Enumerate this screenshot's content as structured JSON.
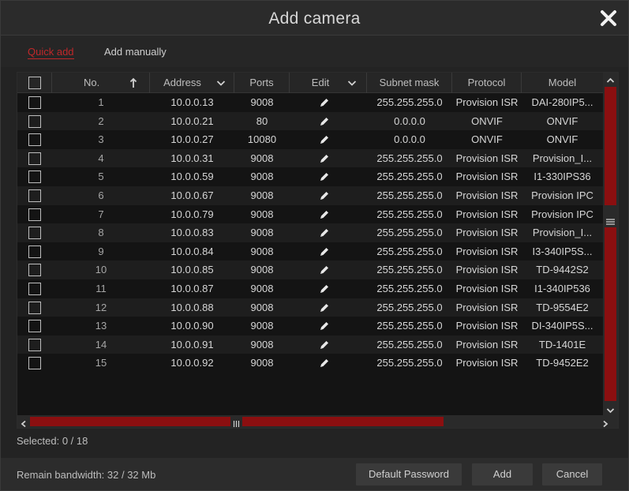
{
  "dialog": {
    "title": "Add camera",
    "close_icon": "close-icon"
  },
  "tabs": [
    {
      "label": "Quick add",
      "active": true
    },
    {
      "label": "Add manually",
      "active": false
    }
  ],
  "columns": [
    "No.",
    "Address",
    "Ports",
    "Edit",
    "Subnet mask",
    "Protocol",
    "Model"
  ],
  "rows": [
    {
      "no": "1",
      "address": "10.0.0.13",
      "port": "9008",
      "subnet": "255.255.255.0",
      "protocol": "Provision ISR",
      "model": "DAI-280IP5..."
    },
    {
      "no": "2",
      "address": "10.0.0.21",
      "port": "80",
      "subnet": "0.0.0.0",
      "protocol": "ONVIF",
      "model": "ONVIF"
    },
    {
      "no": "3",
      "address": "10.0.0.27",
      "port": "10080",
      "subnet": "0.0.0.0",
      "protocol": "ONVIF",
      "model": "ONVIF"
    },
    {
      "no": "4",
      "address": "10.0.0.31",
      "port": "9008",
      "subnet": "255.255.255.0",
      "protocol": "Provision ISR",
      "model": "Provision_I..."
    },
    {
      "no": "5",
      "address": "10.0.0.59",
      "port": "9008",
      "subnet": "255.255.255.0",
      "protocol": "Provision ISR",
      "model": "I1-330IPS36"
    },
    {
      "no": "6",
      "address": "10.0.0.67",
      "port": "9008",
      "subnet": "255.255.255.0",
      "protocol": "Provision ISR",
      "model": "Provision IPC"
    },
    {
      "no": "7",
      "address": "10.0.0.79",
      "port": "9008",
      "subnet": "255.255.255.0",
      "protocol": "Provision ISR",
      "model": "Provision IPC"
    },
    {
      "no": "8",
      "address": "10.0.0.83",
      "port": "9008",
      "subnet": "255.255.255.0",
      "protocol": "Provision ISR",
      "model": "Provision_I..."
    },
    {
      "no": "9",
      "address": "10.0.0.84",
      "port": "9008",
      "subnet": "255.255.255.0",
      "protocol": "Provision ISR",
      "model": "I3-340IP5S..."
    },
    {
      "no": "10",
      "address": "10.0.0.85",
      "port": "9008",
      "subnet": "255.255.255.0",
      "protocol": "Provision ISR",
      "model": "TD-9442S2"
    },
    {
      "no": "11",
      "address": "10.0.0.87",
      "port": "9008",
      "subnet": "255.255.255.0",
      "protocol": "Provision ISR",
      "model": "I1-340IP536"
    },
    {
      "no": "12",
      "address": "10.0.0.88",
      "port": "9008",
      "subnet": "255.255.255.0",
      "protocol": "Provision ISR",
      "model": "TD-9554E2"
    },
    {
      "no": "13",
      "address": "10.0.0.90",
      "port": "9008",
      "subnet": "255.255.255.0",
      "protocol": "Provision ISR",
      "model": "DI-340IP5S..."
    },
    {
      "no": "14",
      "address": "10.0.0.91",
      "port": "9008",
      "subnet": "255.255.255.0",
      "protocol": "Provision ISR",
      "model": "TD-1401E"
    },
    {
      "no": "15",
      "address": "10.0.0.92",
      "port": "9008",
      "subnet": "255.255.255.0",
      "protocol": "Provision ISR",
      "model": "TD-9452E2"
    }
  ],
  "status": {
    "selected": "Selected: 0 / 18",
    "bandwidth": "Remain bandwidth: 32 / 32 Mb"
  },
  "buttons": {
    "default_password": "Default Password",
    "add": "Add",
    "cancel": "Cancel"
  },
  "colors": {
    "accent": "#c0282a",
    "scroll_thumb": "#8b0f10",
    "background": "#232323"
  }
}
